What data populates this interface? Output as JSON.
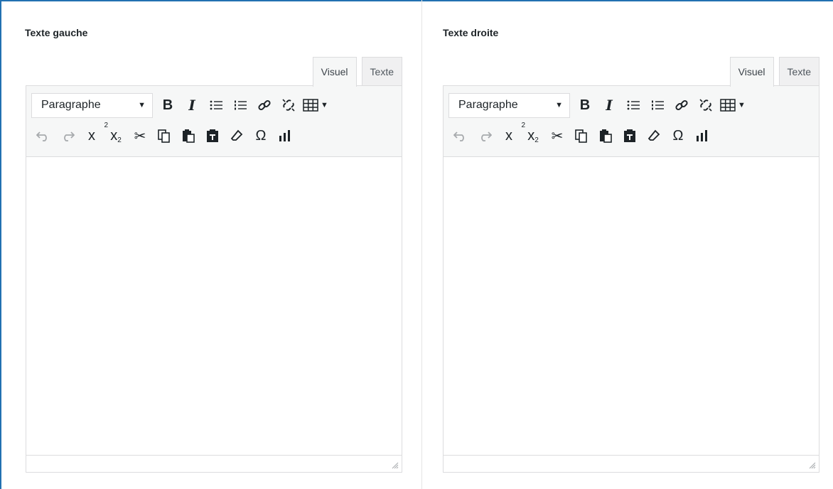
{
  "left": {
    "label": "Texte gauche",
    "tabs": [
      {
        "label": "Visuel",
        "active": true
      },
      {
        "label": "Texte",
        "active": false
      }
    ],
    "format": "Paragraphe"
  },
  "right": {
    "label": "Texte droite",
    "tabs": [
      {
        "label": "Visuel",
        "active": true
      },
      {
        "label": "Texte",
        "active": false
      }
    ],
    "format": "Paragraphe"
  },
  "toolbar": {
    "row1": [
      "bold",
      "italic",
      "bullet-list",
      "numbered-list",
      "link",
      "unlink",
      "table"
    ],
    "row2": [
      "undo",
      "redo",
      "superscript",
      "subscript",
      "cut",
      "copy",
      "paste",
      "paste-as-text",
      "clear-formatting",
      "special-character",
      "chart"
    ],
    "glyphs": {
      "bold": "B",
      "italic": "I",
      "superscript": "x",
      "subscript": "x",
      "special_character": "Ω"
    }
  },
  "colors": {
    "accent": "#2271b1",
    "toolbar_bg": "#f6f7f7",
    "border": "#dcdcde"
  }
}
